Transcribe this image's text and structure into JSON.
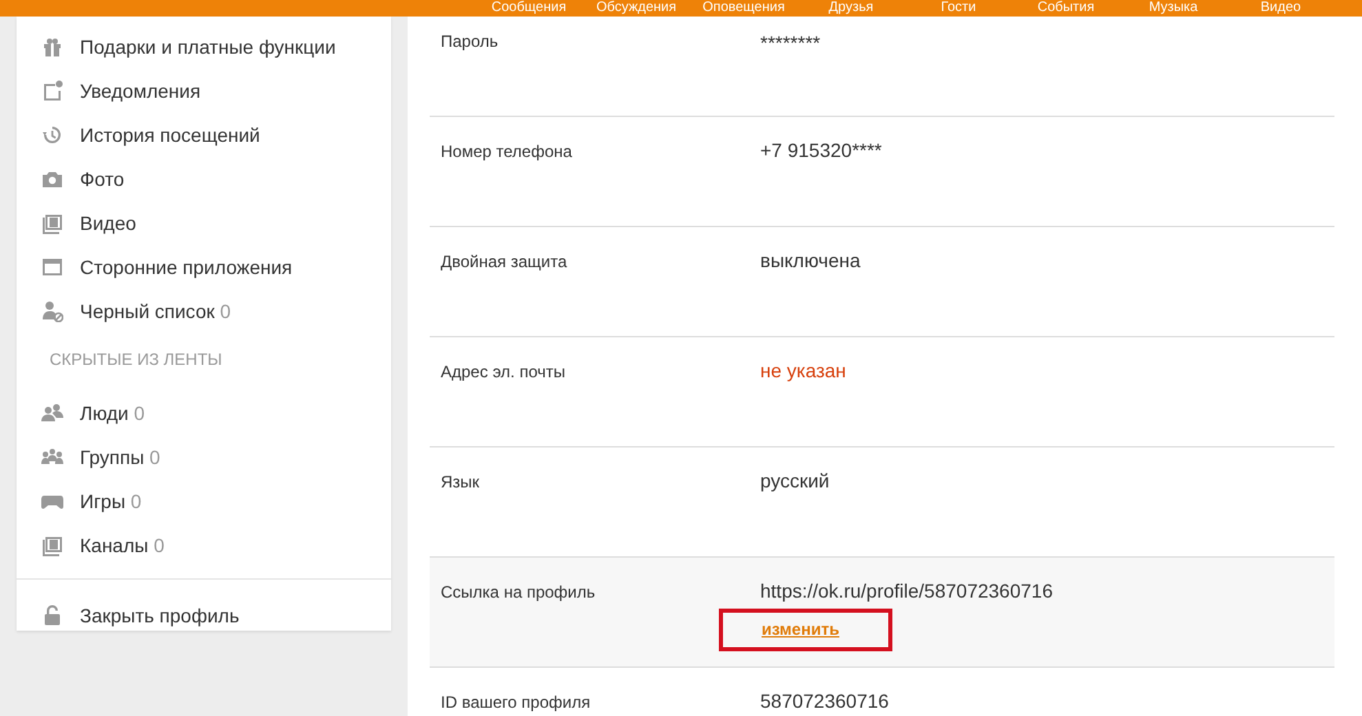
{
  "top_nav": [
    "Сообщения",
    "Обсуждения",
    "Оповещения",
    "Друзья",
    "Гости",
    "События",
    "Музыка",
    "Видео"
  ],
  "sidebar": {
    "items": [
      {
        "label": "Подарки и платные функции"
      },
      {
        "label": "Уведомления"
      },
      {
        "label": "История посещений"
      },
      {
        "label": "Фото"
      },
      {
        "label": "Видео"
      },
      {
        "label": "Сторонние приложения"
      },
      {
        "label": "Черный список",
        "count": "0"
      }
    ],
    "section_title": "СКРЫТЫЕ ИЗ ЛЕНТЫ",
    "hidden_items": [
      {
        "label": "Люди",
        "count": "0"
      },
      {
        "label": "Группы",
        "count": "0"
      },
      {
        "label": "Игры",
        "count": "0"
      },
      {
        "label": "Каналы",
        "count": "0"
      }
    ],
    "footer_item": {
      "label": "Закрыть профиль"
    }
  },
  "settings": [
    {
      "label": "Пароль",
      "value": "********",
      "kind": "plain"
    },
    {
      "label": "Номер телефона",
      "value": "+7 915320****",
      "kind": "plain"
    },
    {
      "label": "Двойная защита",
      "value": "выключена",
      "kind": "plain"
    },
    {
      "label": "Адрес эл. почты",
      "value": "не указан",
      "kind": "warning"
    },
    {
      "label": "Язык",
      "value": "русский",
      "kind": "plain"
    },
    {
      "label": "Ссылка на профиль",
      "value": "https://ok.ru/profile/587072360716",
      "kind": "link",
      "link": "изменить",
      "highlighted": true
    },
    {
      "label": "ID вашего профиля",
      "value": "587072360716",
      "kind": "plain"
    }
  ]
}
